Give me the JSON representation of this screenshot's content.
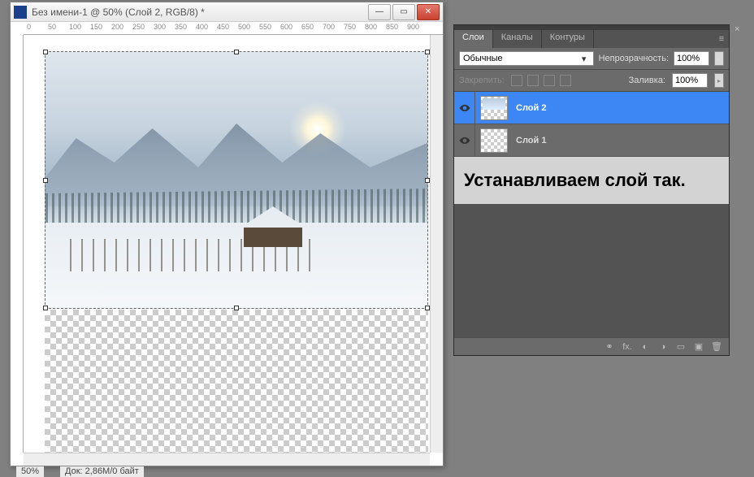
{
  "document": {
    "title": "Без имени-1 @ 50% (Слой 2, RGB/8) *",
    "zoom": "50%",
    "doc_info": "Док: 2,86M/0 байт",
    "ruler_marks": [
      "0",
      "50",
      "100",
      "150",
      "200",
      "250",
      "300",
      "350",
      "400",
      "450",
      "500",
      "550",
      "600",
      "650",
      "700",
      "750",
      "800",
      "850",
      "900"
    ]
  },
  "panel": {
    "tabs": {
      "layers": "Слои",
      "channels": "Каналы",
      "paths": "Контуры"
    },
    "blend_mode": "Обычные",
    "opacity_label": "Непрозрачность:",
    "opacity_value": "100%",
    "lock_label": "Закрепить:",
    "fill_label": "Заливка:",
    "fill_value": "100%",
    "layers": [
      {
        "name": "Слой 2",
        "selected": true,
        "has_image": true
      },
      {
        "name": "Слой 1",
        "selected": false,
        "has_image": false
      }
    ],
    "annotation": "Устанавливаем слой так.",
    "footer_fx": "fx."
  }
}
